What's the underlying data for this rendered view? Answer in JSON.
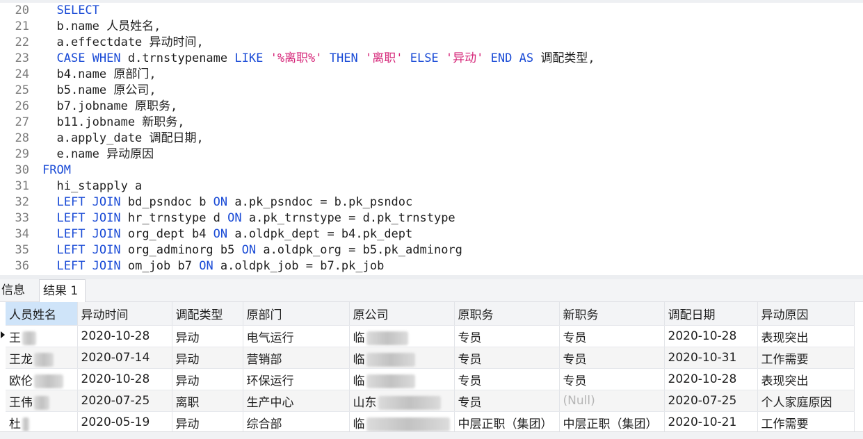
{
  "editor": {
    "lines": [
      {
        "n": "20",
        "tokens": [
          {
            "t": "  "
          },
          {
            "t": "SELECT",
            "c": "kw"
          }
        ]
      },
      {
        "n": "21",
        "tokens": [
          {
            "t": "  b.name 人员姓名,"
          }
        ]
      },
      {
        "n": "22",
        "tokens": [
          {
            "t": "  a.effectdate 异动时间,"
          }
        ]
      },
      {
        "n": "23",
        "tokens": [
          {
            "t": "  "
          },
          {
            "t": "CASE WHEN",
            "c": "kw"
          },
          {
            "t": " d.trnstypename "
          },
          {
            "t": "LIKE",
            "c": "kw"
          },
          {
            "t": " "
          },
          {
            "t": "'%离职%'",
            "c": "str"
          },
          {
            "t": " "
          },
          {
            "t": "THEN",
            "c": "kw"
          },
          {
            "t": " "
          },
          {
            "t": "'离职'",
            "c": "str"
          },
          {
            "t": " "
          },
          {
            "t": "ELSE",
            "c": "kw"
          },
          {
            "t": " "
          },
          {
            "t": "'异动'",
            "c": "str"
          },
          {
            "t": " "
          },
          {
            "t": "END AS",
            "c": "kw"
          },
          {
            "t": " 调配类型,"
          }
        ]
      },
      {
        "n": "24",
        "tokens": [
          {
            "t": "  b4.name 原部门,"
          }
        ]
      },
      {
        "n": "25",
        "tokens": [
          {
            "t": "  b5.name 原公司,"
          }
        ]
      },
      {
        "n": "26",
        "tokens": [
          {
            "t": "  b7.jobname 原职务,"
          }
        ]
      },
      {
        "n": "27",
        "tokens": [
          {
            "t": "  b11.jobname 新职务,"
          }
        ]
      },
      {
        "n": "28",
        "tokens": [
          {
            "t": "  a.apply_date 调配日期,"
          }
        ]
      },
      {
        "n": "29",
        "tokens": [
          {
            "t": "  e.name 异动原因"
          }
        ]
      },
      {
        "n": "30",
        "tokens": [
          {
            "t": "FROM",
            "c": "kw"
          }
        ]
      },
      {
        "n": "31",
        "tokens": [
          {
            "t": "  hi_stapply a"
          }
        ]
      },
      {
        "n": "32",
        "tokens": [
          {
            "t": "  "
          },
          {
            "t": "LEFT JOIN",
            "c": "kw"
          },
          {
            "t": " bd_psndoc b "
          },
          {
            "t": "ON",
            "c": "kw"
          },
          {
            "t": " a.pk_psndoc = b.pk_psndoc"
          }
        ]
      },
      {
        "n": "33",
        "tokens": [
          {
            "t": "  "
          },
          {
            "t": "LEFT JOIN",
            "c": "kw"
          },
          {
            "t": " hr_trnstype d "
          },
          {
            "t": "ON",
            "c": "kw"
          },
          {
            "t": " a.pk_trnstype = d.pk_trnstype"
          }
        ]
      },
      {
        "n": "34",
        "tokens": [
          {
            "t": "  "
          },
          {
            "t": "LEFT JOIN",
            "c": "kw"
          },
          {
            "t": " org_dept b4 "
          },
          {
            "t": "ON",
            "c": "kw"
          },
          {
            "t": " a.oldpk_dept = b4.pk_dept"
          }
        ]
      },
      {
        "n": "35",
        "tokens": [
          {
            "t": "  "
          },
          {
            "t": "LEFT JOIN",
            "c": "kw"
          },
          {
            "t": " org_adminorg b5 "
          },
          {
            "t": "ON",
            "c": "kw"
          },
          {
            "t": " a.oldpk_org = b5.pk_adminorg"
          }
        ]
      },
      {
        "n": "36",
        "tokens": [
          {
            "t": "  "
          },
          {
            "t": "LEFT JOIN",
            "c": "kw"
          },
          {
            "t": " om_job b7 "
          },
          {
            "t": "ON",
            "c": "kw"
          },
          {
            "t": " a.oldpk_job = b7.pk_job"
          }
        ]
      }
    ]
  },
  "tabs": {
    "info": "信息",
    "result1": "结果 1"
  },
  "grid": {
    "columns": [
      "人员姓名",
      "异动时间",
      "调配类型",
      "原部门",
      "原公司",
      "原职务",
      "新职务",
      "调配日期",
      "异动原因"
    ],
    "rows": [
      [
        "王",
        "2020-10-28",
        "异动",
        "电气运行",
        "临",
        "专员",
        "专员",
        "2020-10-28",
        "表现突出"
      ],
      [
        "王龙",
        "2020-07-14",
        "异动",
        "营销部",
        "临",
        "专员",
        "专员",
        "2020-10-31",
        "工作需要"
      ],
      [
        "欧伦",
        "2020-10-28",
        "异动",
        "环保运行",
        "临",
        "专员",
        "专员",
        "2020-10-28",
        "表现突出"
      ],
      [
        "王伟",
        "2020-07-25",
        "离职",
        "生产中心",
        "山东",
        "专员",
        "(Null)",
        "2020-07-25",
        "个人家庭原因"
      ],
      [
        "杜",
        "2020-05-19",
        "异动",
        "综合部",
        "临",
        "中层正职（集团）",
        "中层正职（集团）",
        "2020-10-21",
        "工作需要"
      ]
    ]
  },
  "colors": {
    "keyword": "#1a4bd6",
    "string": "#d6287a",
    "selected_header": "#cfe4f9",
    "null_text": "#b5b5b5"
  }
}
